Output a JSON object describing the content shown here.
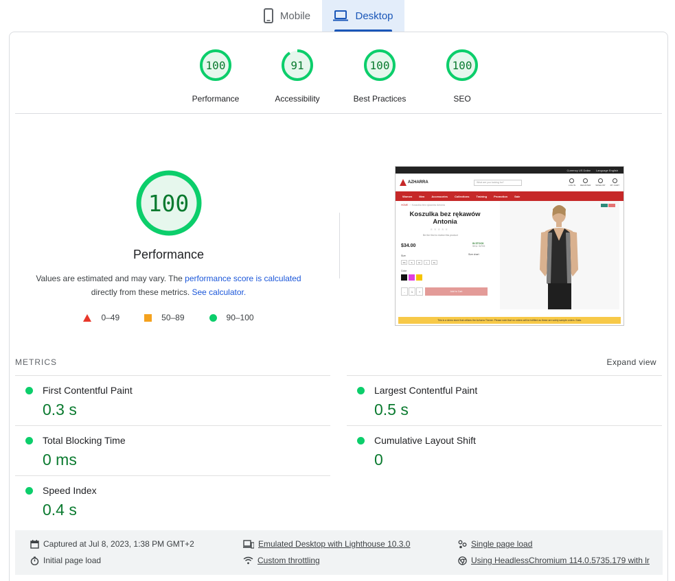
{
  "tabs": [
    {
      "label": "Mobile",
      "icon": "mobile-phone-icon",
      "active": false
    },
    {
      "label": "Desktop",
      "icon": "laptop-icon",
      "active": true
    }
  ],
  "scores": [
    {
      "label": "Performance",
      "value": "100",
      "fraction": 1.0
    },
    {
      "label": "Accessibility",
      "value": "91",
      "fraction": 0.91
    },
    {
      "label": "Best Practices",
      "value": "100",
      "fraction": 1.0
    },
    {
      "label": "SEO",
      "value": "100",
      "fraction": 1.0
    }
  ],
  "main": {
    "score": "100",
    "title": "Performance",
    "note_pre": "Values are estimated and may vary. The ",
    "note_link1": "performance score is calculated",
    "note_mid": " directly from these metrics. ",
    "note_link2": "See calculator.",
    "legend": [
      {
        "shape": "triangle",
        "color": "#e8372a",
        "label": "0–49"
      },
      {
        "shape": "square",
        "color": "#f4a21e",
        "label": "50–89"
      },
      {
        "shape": "circle",
        "color": "#0cce6b",
        "label": "90–100"
      }
    ]
  },
  "screenshot": {
    "topbar": [
      "Currency US Dollar",
      "Language English"
    ],
    "logo": "AZHARRA",
    "search_placeholder": "What are you looking for?",
    "icons": [
      "LOG IN",
      "REGISTER",
      "WISHLIST",
      "MY CART"
    ],
    "nav": [
      "Women",
      "Men",
      "Accessories",
      "Collections",
      "Training",
      "Promotion",
      "Sale"
    ],
    "breadcrumb_home": "HOME",
    "breadcrumb_page": "Koszulka bez rękawów Antonia",
    "product_title": "Koszulka bez rękawów Antonia",
    "review_prompt": "Be the first to review this product",
    "price": "$34.00",
    "stock": "IN STOCK",
    "sku": "SKU: W709",
    "size_label": "Size",
    "sizes": [
      "XS",
      "S",
      "M",
      "L",
      "XL"
    ],
    "size_chart": "Size chart",
    "color_label": "Color",
    "swatches": [
      "#111111",
      "#e040e0",
      "#f5c400"
    ],
    "qty": "1",
    "add_to_cart": "Add to Cart",
    "banner": "This is a demo store that utilizes the Azharra Theme. Please note that no orders will be fulfilled as these are solely sample orders. Data."
  },
  "metrics": {
    "title": "METRICS",
    "expand": "Expand view",
    "status_color": "#0cce6b",
    "left": [
      {
        "name": "First Contentful Paint",
        "value": "0.3 s"
      },
      {
        "name": "Total Blocking Time",
        "value": "0 ms"
      },
      {
        "name": "Speed Index",
        "value": "0.4 s"
      }
    ],
    "right": [
      {
        "name": "Largest Contentful Paint",
        "value": "0.5 s"
      },
      {
        "name": "Cumulative Layout Shift",
        "value": "0"
      }
    ]
  },
  "info": {
    "captured": "Captured at Jul 8, 2023, 1:38 PM GMT+2",
    "initial": "Initial page load",
    "emulated": "Emulated Desktop with Lighthouse 10.3.0",
    "throttling": "Custom throttling",
    "single": "Single page load",
    "using": "Using HeadlessChromium 114.0.5735.179 with lr"
  },
  "colors": {
    "pass_green": "#0cce6b",
    "score_text": "#0a7a2f",
    "ring_bg": "#e6f7ed",
    "accent_blue": "#1a56b8"
  }
}
